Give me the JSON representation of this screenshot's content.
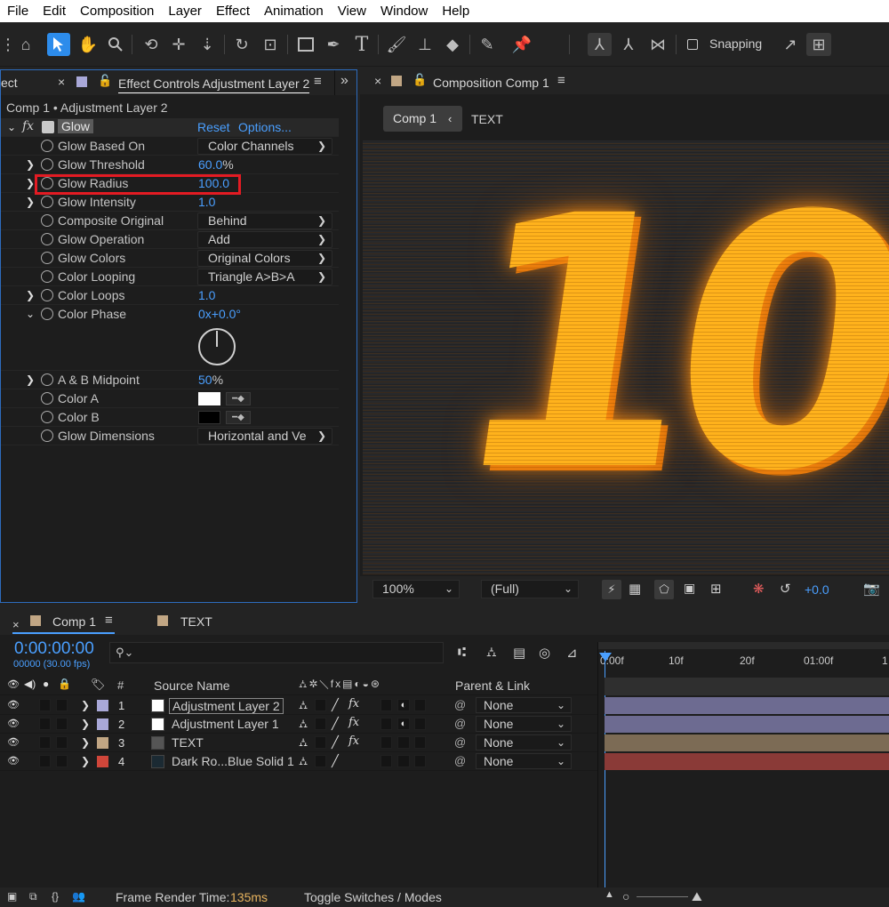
{
  "menu": [
    "File",
    "Edit",
    "Composition",
    "Layer",
    "Effect",
    "Animation",
    "View",
    "Window",
    "Help"
  ],
  "toolbar": {
    "snapping_label": "Snapping"
  },
  "effect_panel": {
    "left_tab_fragment": "ect",
    "tab_title": "Effect Controls Adjustment Layer 2",
    "breadcrumb": "Comp 1 • Adjustment Layer 2",
    "effect_name": "Glow",
    "reset_label": "Reset",
    "options_label": "Options...",
    "params": {
      "glow_based_on": {
        "label": "Glow Based On",
        "value": "Color Channels"
      },
      "glow_threshold": {
        "label": "Glow Threshold",
        "value": "60.0",
        "unit": "%"
      },
      "glow_radius": {
        "label": "Glow Radius",
        "value": "100.0"
      },
      "glow_intensity": {
        "label": "Glow Intensity",
        "value": "1.0"
      },
      "composite_original": {
        "label": "Composite Original",
        "value": "Behind"
      },
      "glow_operation": {
        "label": "Glow Operation",
        "value": "Add"
      },
      "glow_colors": {
        "label": "Glow Colors",
        "value": "Original Colors"
      },
      "color_looping": {
        "label": "Color Looping",
        "value": "Triangle A>B>A"
      },
      "color_loops": {
        "label": "Color Loops",
        "value": "1.0"
      },
      "color_phase": {
        "label": "Color Phase",
        "rev": "0x",
        "deg": "+0.0°"
      },
      "ab_midpoint": {
        "label": "A & B Midpoint",
        "value": "50",
        "unit": "%"
      },
      "color_a": {
        "label": "Color A",
        "color": "#ffffff"
      },
      "color_b": {
        "label": "Color B",
        "color": "#000000"
      },
      "glow_dimensions": {
        "label": "Glow Dimensions",
        "value": "Horizontal and Ve"
      }
    }
  },
  "comp_panel": {
    "tab_title": "Composition Comp 1",
    "crumb_comp": "Comp 1",
    "crumb_layer": "TEXT",
    "preview_text": "10:",
    "zoom": "100%",
    "resolution": "(Full)",
    "exposure": "+0.0"
  },
  "timeline": {
    "tabs": [
      "Comp 1",
      "TEXT"
    ],
    "timecode": "0:00:00:00",
    "frames": "00000 (30.00 fps)",
    "search_placeholder": "",
    "col_source_name": "Source Name",
    "col_parent": "Parent & Link",
    "col_num": "#",
    "ruler": [
      "0:00f",
      "10f",
      "20f",
      "01:00f",
      "1"
    ],
    "layers": [
      {
        "num": "1",
        "name": "Adjustment Layer 2",
        "label_color": "#a9a8d8",
        "parent": "None",
        "bar_color": "#6d6b91"
      },
      {
        "num": "2",
        "name": "Adjustment Layer 1",
        "label_color": "#a9a8d8",
        "parent": "None",
        "bar_color": "#6d6b91"
      },
      {
        "num": "3",
        "name": "TEXT",
        "label_color": "#c1a684",
        "parent": "None",
        "bar_color": "#7c6b55"
      },
      {
        "num": "4",
        "name": "Dark Ro...Blue Solid 1",
        "label_color": "#d0463a",
        "parent": "None",
        "bar_color": "#8a3a37"
      }
    ]
  },
  "statusbar": {
    "render_label": "Frame Render Time:",
    "render_value": "135ms",
    "toggle_label": "Toggle Switches / Modes"
  },
  "colors": {
    "accent_blue": "#4a9fff",
    "highlight_red": "#e31b23",
    "glow_orange": "#ff9a14"
  }
}
